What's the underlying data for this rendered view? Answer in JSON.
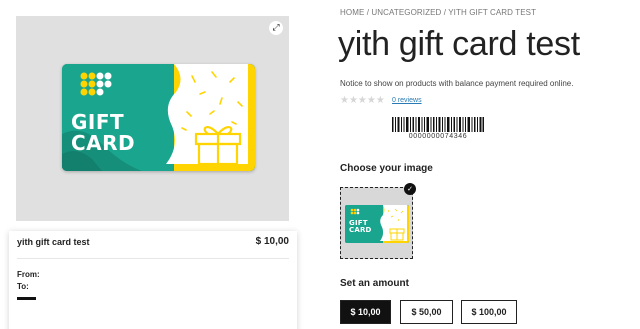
{
  "breadcrumb": {
    "home": "HOME",
    "sep1": " / ",
    "category": "UNCATEGORIZED",
    "sep2": " / ",
    "current": "YITH GIFT CARD TEST"
  },
  "product": {
    "title": "yith gift card test",
    "notice": "Notice to show on products with balance payment required online.",
    "stars": "★★★★★",
    "rating": 0,
    "reviews_link": "0 reviews",
    "barcode_number": "0000000074346"
  },
  "gallery": {
    "card_text_line1": "GIFT",
    "card_text_line2": "CARD",
    "zoom_icon": "expand-icon",
    "zoom_glyph": "⤢"
  },
  "colors": {
    "card_teal": "#1aa68e",
    "card_yellow": "#ffd400",
    "accent_dark": "#111111"
  },
  "preview": {
    "title": "yith gift card test",
    "price": "$ 10,00",
    "from_label": "From:",
    "to_label": "To:"
  },
  "choose_image": {
    "label": "Choose your image",
    "selected_glyph": "✓",
    "thumb_text_line1": "GIFT",
    "thumb_text_line2": "CARD"
  },
  "amount": {
    "label": "Set an amount",
    "options": [
      "$ 10,00",
      "$ 50,00",
      "$ 100,00"
    ],
    "selected": "$ 10,00"
  }
}
